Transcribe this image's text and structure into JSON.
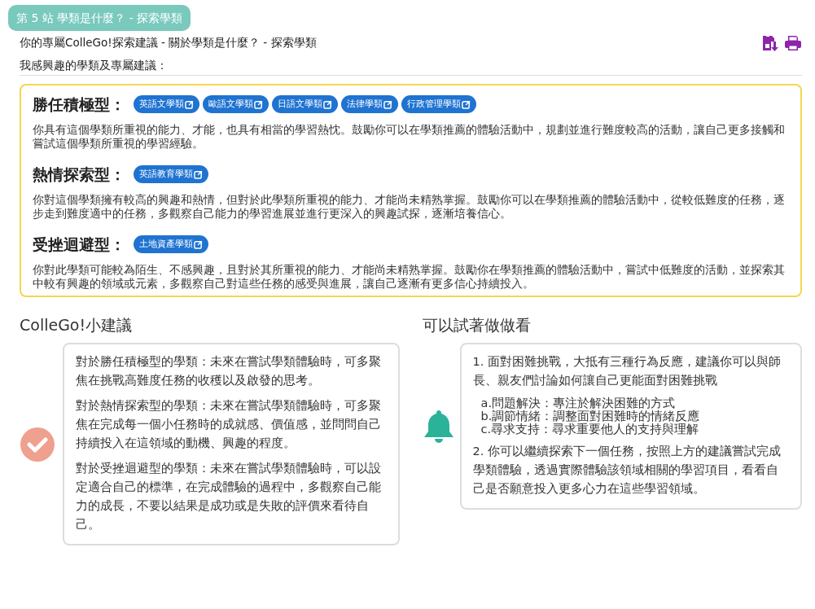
{
  "station_tag": "第 5 站 學類是什麼？ - 探索學類",
  "subtitle": "你的專屬ColleGo!探索建議 - 關於學類是什麼？ - 探索學類",
  "interest_label": "我感興趣的學類及專屬建議：",
  "groups": [
    {
      "title": "勝任積極型：",
      "majors": [
        "英語文學類",
        "歐語文學類",
        "日語文學類",
        "法律學類",
        "行政管理學類"
      ],
      "description": "你具有這個學類所重視的能力、才能，也具有相當的學習熱忱。鼓勵你可以在學類推薦的體驗活動中，規劃並進行難度較高的活動，讓自己更多接觸和嘗試這個學類所重視的學習經驗。"
    },
    {
      "title": "熱情探索型：",
      "majors": [
        "英語教育學類"
      ],
      "description": "你對這個學類擁有較高的興趣和熱情，但對於此學類所重視的能力、才能尚未精熟掌握。鼓勵你可以在學類推薦的體驗活動中，從較低難度的任務，逐步走到難度適中的任務，多觀察自己能力的學習進展並進行更深入的興趣試探，逐漸培養信心。"
    },
    {
      "title": "受挫迴避型：",
      "majors": [
        "土地資產學類"
      ],
      "description": "你對此學類可能較為陌生、不感興趣，且對於其所重視的能力、才能尚未精熟掌握。鼓勵你在學類推薦的體驗活動中，嘗試中低難度的活動，並探索其中較有興趣的領域或元素，多觀察自己對這些任務的感受與進展，讓自己逐漸有更多信心持續投入。"
    }
  ],
  "tips_panel": {
    "title": "ColleGo!小建議",
    "paragraphs": [
      "對於勝任積極型的學類：未來在嘗試學類體驗時，可多聚焦在挑戰高難度任務的收穫以及啟發的思考。",
      "對於熱情探索型的學類：未來在嘗試學類體驗時，可多聚焦在完成每一個小任務時的成就感、價值感，並問問自己持續投入在這領域的動機、興趣的程度。",
      "對於受挫迴避型的學類：未來在嘗試學類體驗時，可以設定適合自己的標準，在完成體驗的過程中，多觀察自己能力的成長，不要以結果是成功或是失敗的評價來看待自己。"
    ]
  },
  "try_panel": {
    "title": "可以試著做做看",
    "items": [
      {
        "kind": "paragraph",
        "text": "1. 面對困難挑戰，大抵有三種行為反應，建議你可以與師長、親友們討論如何讓自己更能面對困難挑戰"
      },
      {
        "kind": "sublist",
        "lines": [
          "a.問題解決：專注於解決困難的方式",
          "b.調節情緒：調整面對困難時的情緒反應",
          "c.尋求支持：尋求重要他人的支持與理解"
        ]
      },
      {
        "kind": "paragraph",
        "text": "2. 你可以繼續探索下一個任務，按照上方的建議嘗試完成學類體驗，透過實際體驗該領域相關的學習項目，看看自己是否願意投入更多心力在這些學習領域。"
      }
    ]
  }
}
